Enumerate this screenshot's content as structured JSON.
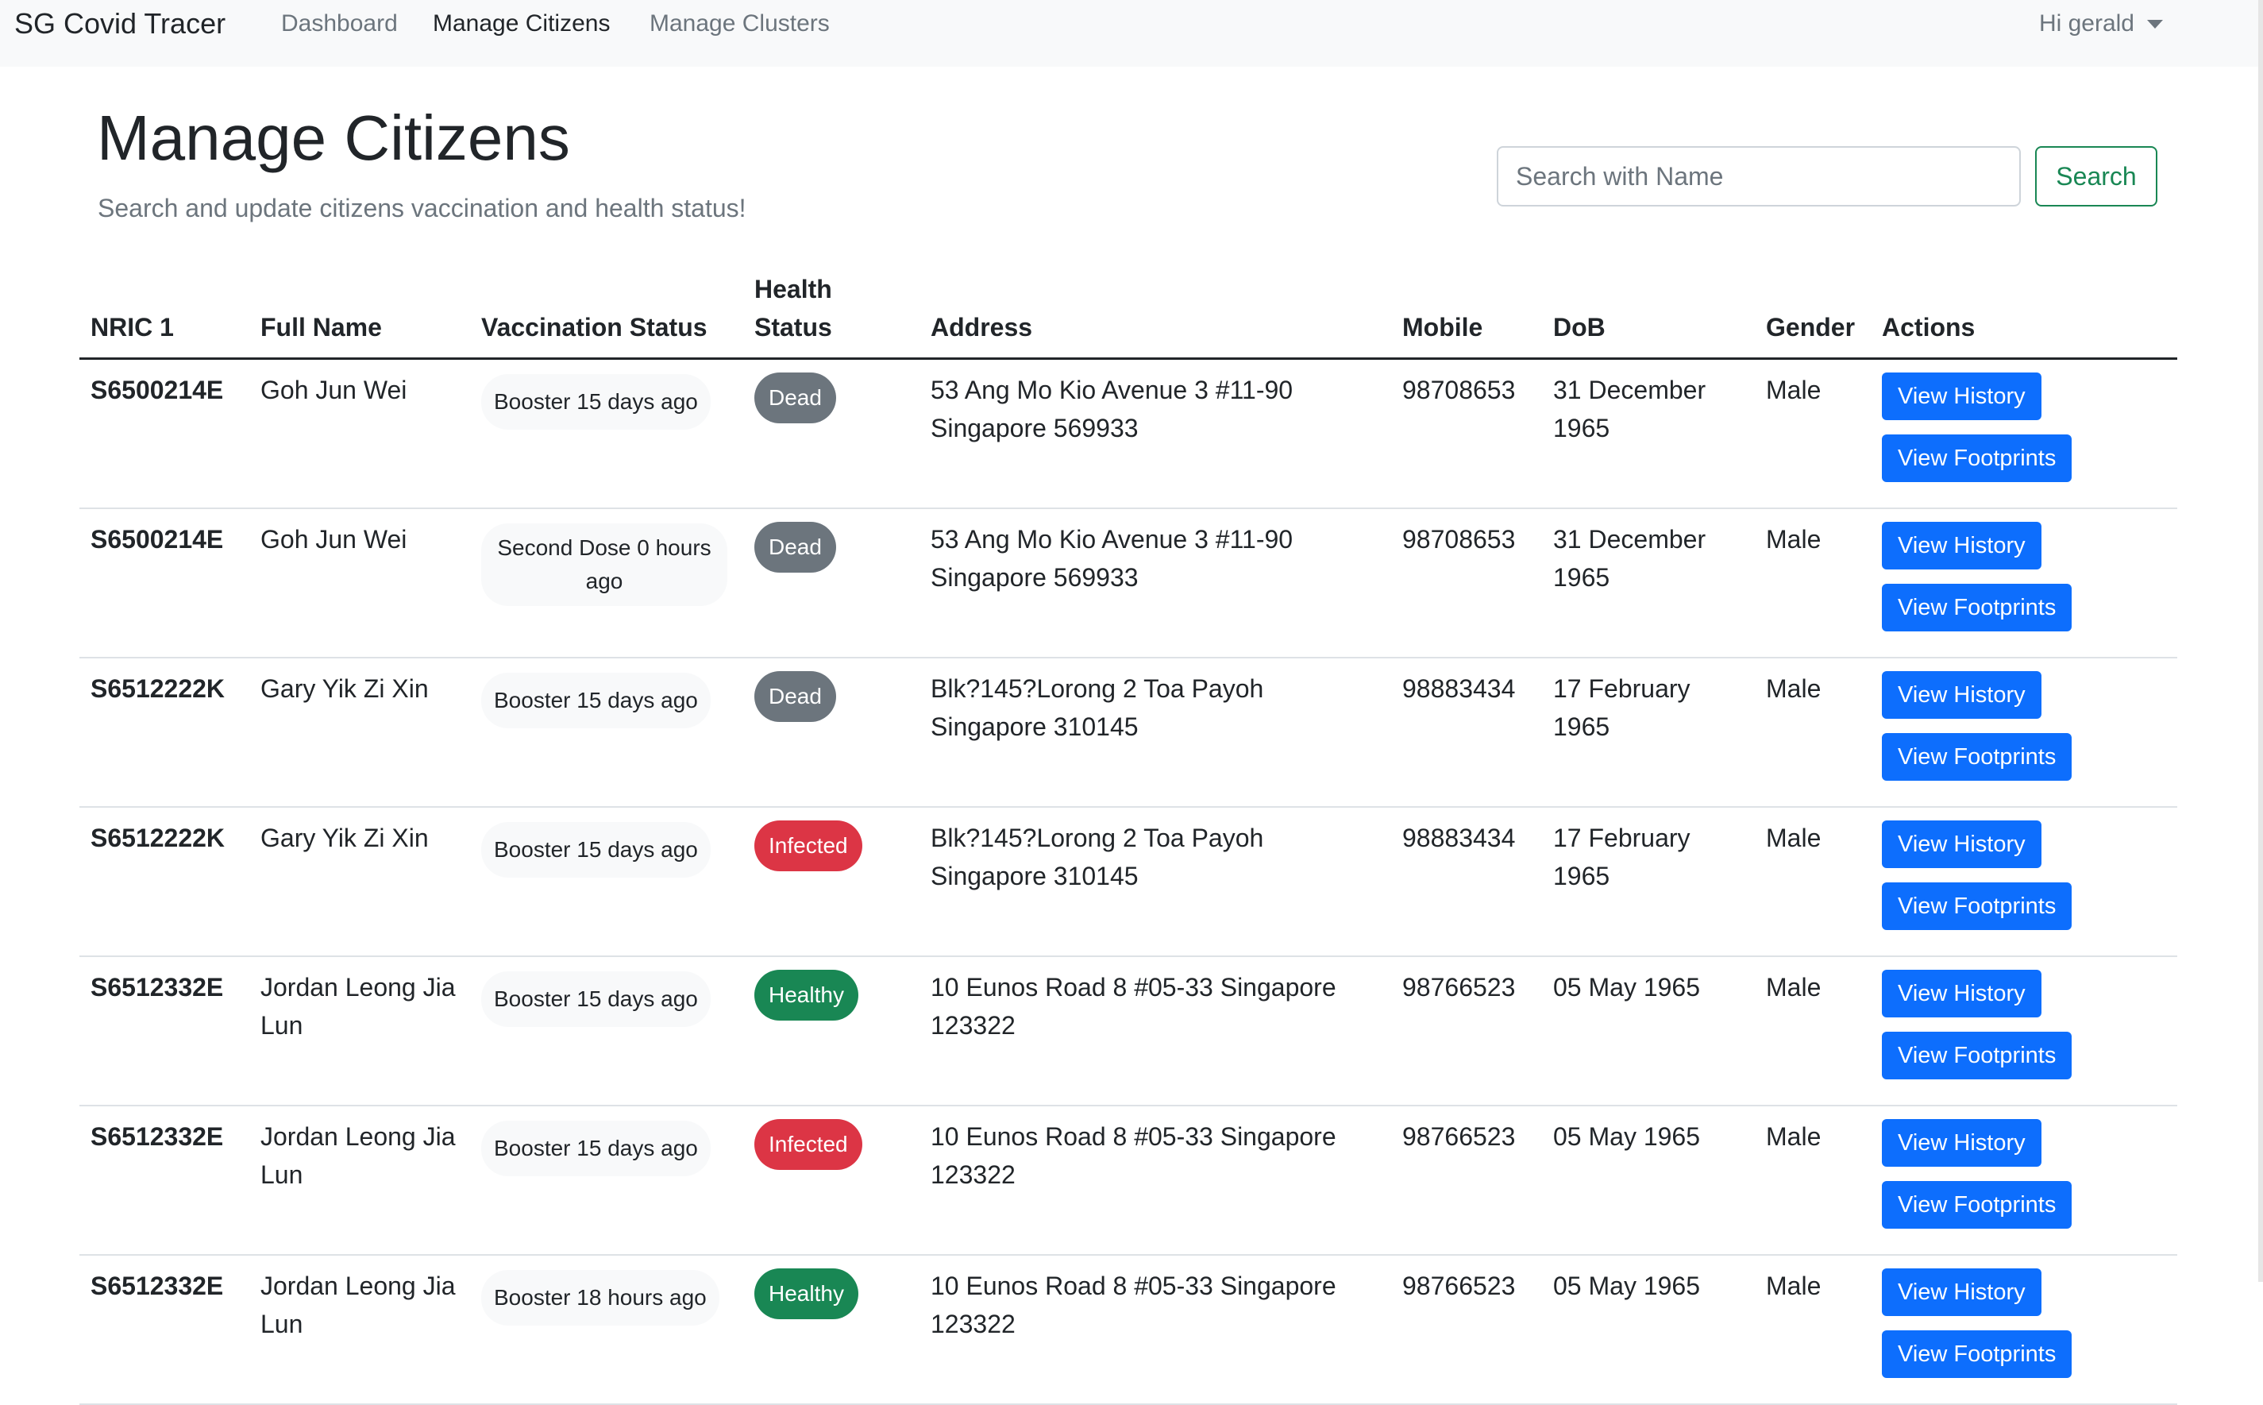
{
  "navbar": {
    "brand": "SG Covid Tracer",
    "links": [
      "Dashboard",
      "Manage Citizens",
      "Manage Clusters"
    ],
    "active": "Manage Citizens",
    "user": "Hi gerald"
  },
  "header": {
    "title": "Manage Citizens",
    "subtitle": "Search and update citizens vaccination and health status!"
  },
  "search": {
    "placeholder": "Search with Name",
    "value": "",
    "button_label": "Search"
  },
  "table": {
    "columns": {
      "nric": "NRIC 1",
      "full_name": "Full Name",
      "vaccination": "Vaccination Status",
      "health": "Health Status",
      "address": "Address",
      "mobile": "Mobile",
      "dob": "DoB",
      "gender": "Gender",
      "actions": "Actions"
    },
    "action_labels": {
      "history": "View History",
      "footprints": "View Footprints"
    },
    "rows": [
      {
        "nric": "S6500214E",
        "full_name": "Goh Jun Wei",
        "vaccination": "Booster 15 days ago",
        "health": "Dead",
        "address": "53 Ang Mo Kio Avenue 3 #11-90 Singapore 569933",
        "mobile": "98708653",
        "dob": "31 December 1965",
        "gender": "Male"
      },
      {
        "nric": "S6500214E",
        "full_name": "Goh Jun Wei",
        "vaccination": "Second Dose 0 hours ago",
        "health": "Dead",
        "address": "53 Ang Mo Kio Avenue 3 #11-90 Singapore 569933",
        "mobile": "98708653",
        "dob": "31 December 1965",
        "gender": "Male"
      },
      {
        "nric": "S6512222K",
        "full_name": "Gary Yik Zi Xin",
        "vaccination": "Booster 15 days ago",
        "health": "Dead",
        "address": "Blk?145?Lorong 2 Toa Payoh Singapore 310145",
        "mobile": "98883434",
        "dob": "17 February 1965",
        "gender": "Male"
      },
      {
        "nric": "S6512222K",
        "full_name": "Gary Yik Zi Xin",
        "vaccination": "Booster 15 days ago",
        "health": "Infected",
        "address": "Blk?145?Lorong 2 Toa Payoh Singapore 310145",
        "mobile": "98883434",
        "dob": "17 February 1965",
        "gender": "Male"
      },
      {
        "nric": "S6512332E",
        "full_name": "Jordan Leong Jia Lun",
        "vaccination": "Booster 15 days ago",
        "health": "Healthy",
        "address": "10 Eunos Road 8 #05-33 Singapore 123322",
        "mobile": "98766523",
        "dob": "05 May 1965",
        "gender": "Male"
      },
      {
        "nric": "S6512332E",
        "full_name": "Jordan Leong Jia Lun",
        "vaccination": "Booster 15 days ago",
        "health": "Infected",
        "address": "10 Eunos Road 8 #05-33 Singapore 123322",
        "mobile": "98766523",
        "dob": "05 May 1965",
        "gender": "Male"
      },
      {
        "nric": "S6512332E",
        "full_name": "Jordan Leong Jia Lun",
        "vaccination": "Booster 18 hours ago",
        "health": "Healthy",
        "address": "10 Eunos Road 8 #05-33 Singapore 123322",
        "mobile": "98766523",
        "dob": "05 May 1965",
        "gender": "Male"
      }
    ]
  },
  "colors": {
    "dead": "#6c757d",
    "infected": "#dc3545",
    "healthy": "#198754",
    "primary": "#0d6efd",
    "search_outline": "#198754"
  }
}
